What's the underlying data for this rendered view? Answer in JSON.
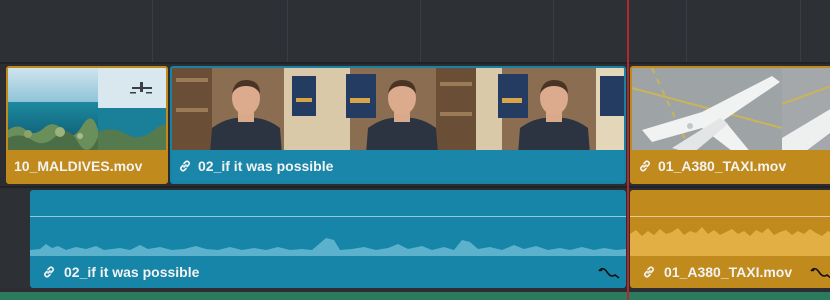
{
  "timeline": {
    "video_clips": [
      {
        "name": "10_MALDIVES.mov",
        "linked": false,
        "color": "#c08a1c"
      },
      {
        "name": "02_if it was possible",
        "linked": true,
        "color": "#1a87aa"
      },
      {
        "name": "01_A380_TAXI.mov",
        "linked": true,
        "color": "#c08a1c"
      }
    ],
    "audio_clips": [
      {
        "name": "02_if it was possible",
        "linked": true,
        "color": "#1685a8"
      },
      {
        "name": "01_A380_TAXI.mov",
        "linked": true,
        "color": "#c08a1c"
      }
    ],
    "playhead_color": "#b3272d",
    "icons": [
      "link-icon",
      "fx-curve-icon"
    ]
  }
}
